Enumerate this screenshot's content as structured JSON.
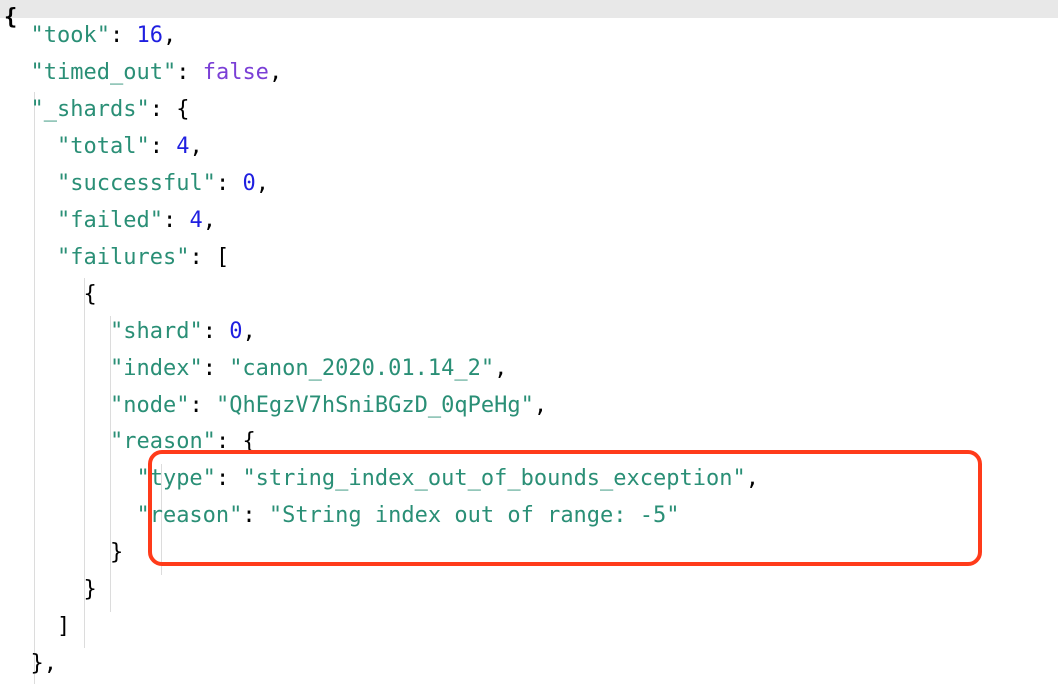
{
  "topBrace": "{",
  "json": {
    "took": {
      "key": "\"took\"",
      "value": "16"
    },
    "timed_out": {
      "key": "\"timed_out\"",
      "value": "false"
    },
    "_shards": {
      "key": "\"_shards\"",
      "total": {
        "key": "\"total\"",
        "value": "4"
      },
      "successful": {
        "key": "\"successful\"",
        "value": "0"
      },
      "failed": {
        "key": "\"failed\"",
        "value": "4"
      },
      "failures": {
        "key": "\"failures\"",
        "item": {
          "shard": {
            "key": "\"shard\"",
            "value": "0"
          },
          "index": {
            "key": "\"index\"",
            "value": "\"canon_2020.01.14_2\""
          },
          "node": {
            "key": "\"node\"",
            "value": "\"QhEgzV7hSniBGzD_0qPeHg\""
          },
          "reason": {
            "key": "\"reason\"",
            "type": {
              "key": "\"type\"",
              "value": "\"string_index_out_of_bounds_exception\""
            },
            "reasonInner": {
              "key": "\"reason\"",
              "value": "\"String index out of range: -5\""
            }
          }
        }
      }
    }
  },
  "punct": {
    "colon": ": ",
    "comma": ",",
    "openBrace": "{",
    "closeBrace": "}",
    "openBracket": "[",
    "closeBracket": "]"
  }
}
